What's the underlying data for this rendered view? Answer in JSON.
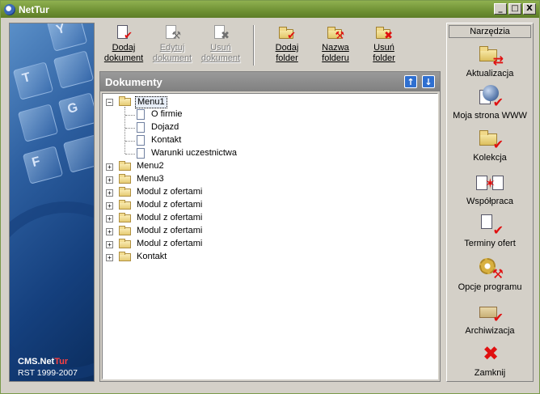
{
  "window": {
    "title": "NetTur",
    "buttons": {
      "minimize": "_",
      "maximize": "□",
      "close": "X"
    }
  },
  "banner": {
    "brand_prefix": "CMS.Net",
    "brand_accent": "Tur",
    "copyright": "RST 1999-2007",
    "key_letters": [
      "Y",
      "T",
      "G",
      "F"
    ]
  },
  "toolbar": {
    "buttons": [
      {
        "line1": "Dodaj",
        "line2": "dokument",
        "enabled": true,
        "mark": "✔"
      },
      {
        "line1": "Edytuj",
        "line2": "dokument",
        "enabled": false,
        "mark": "⚒"
      },
      {
        "line1": "Usuń",
        "line2": "dokument",
        "enabled": false,
        "mark": "✖"
      },
      {
        "line1": "Dodaj",
        "line2": "folder",
        "enabled": true,
        "mark": "✔"
      },
      {
        "line1": "Nazwa",
        "line2": "folderu",
        "enabled": true,
        "mark": "⚒"
      },
      {
        "line1": "Usuń",
        "line2": "folder",
        "enabled": true,
        "mark": "✖"
      }
    ]
  },
  "documents": {
    "title": "Dokumenty",
    "up_arrow": "↑",
    "down_arrow": "↓",
    "tree": {
      "root": {
        "label": "Menu1",
        "expander": "−"
      },
      "children": [
        "O firmie",
        "Dojazd",
        "Kontakt",
        "Warunki uczestnictwa"
      ],
      "siblings": [
        "Menu2",
        "Menu3",
        "Modul z ofertami",
        "Modul z ofertami",
        "Modul z ofertami",
        "Modul z ofertami",
        "Modul z ofertami",
        "Kontakt"
      ],
      "collapsed_expander": "+"
    }
  },
  "tools": {
    "header": "Narzędzia",
    "items": [
      {
        "label": "Aktualizacja"
      },
      {
        "label": "Moja strona WWW"
      },
      {
        "label": "Kolekcja"
      },
      {
        "label": "Współpraca"
      },
      {
        "label": "Terminy ofert"
      },
      {
        "label": "Opcje programu"
      },
      {
        "label": "Archiwizacja"
      },
      {
        "label": "Zamknij"
      }
    ]
  },
  "colors": {
    "titlebar": "#6e9033",
    "panel_header": "#808080",
    "accent_red": "#e01010",
    "banner_blue": "#15407e"
  }
}
